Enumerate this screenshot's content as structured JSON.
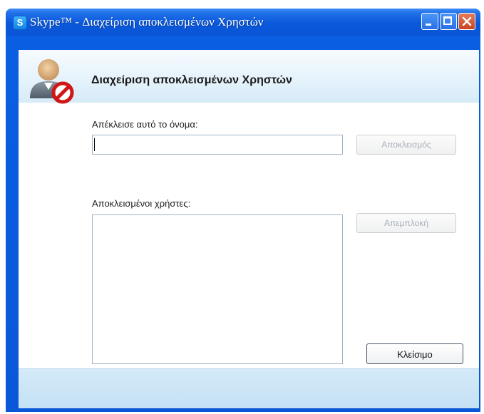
{
  "window": {
    "title": "Skype™ - Διαχείριση αποκλεισμένων Χρηστών",
    "app_icon": "skype-icon",
    "controls": [
      "minimize-icon",
      "maximize-icon",
      "close-icon"
    ]
  },
  "header": {
    "title": "Διαχείριση αποκλεισμένων Χρηστών",
    "icon": "blocked-user-icon"
  },
  "block_section": {
    "label": "Απέκλεισε αυτό το όνομα:",
    "input_value": "",
    "button_label": "Αποκλεισμός"
  },
  "blocked_section": {
    "label": "Αποκλεισμένοι χρήστες:",
    "items": [],
    "button_label": "Απεμπλοκή"
  },
  "footer": {
    "close_label": "Κλείσιμο"
  },
  "colors": {
    "titlebar": "#0a58db",
    "header_band": "#e4f2fb",
    "footer_band": "#c4e1f5",
    "disabled_text": "#a8b0b8"
  }
}
